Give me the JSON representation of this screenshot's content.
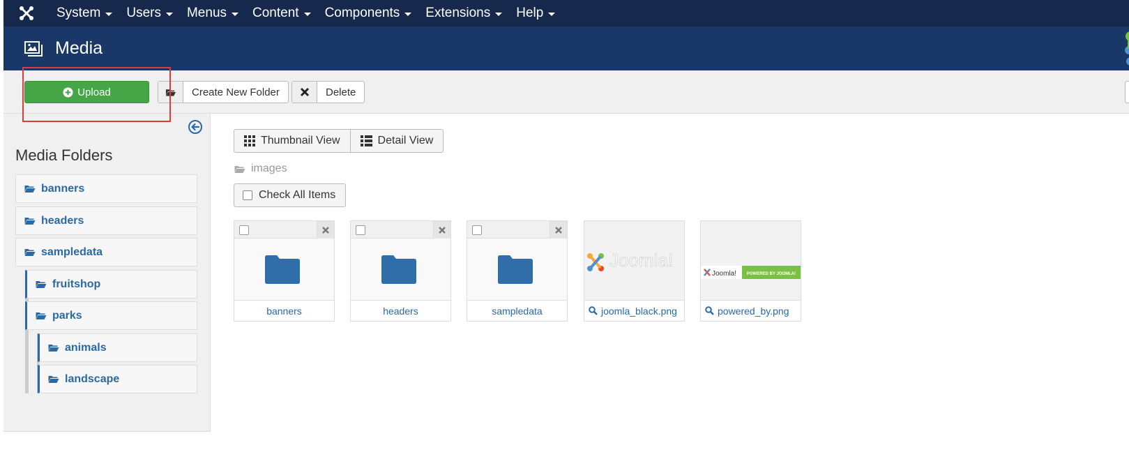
{
  "topnav": {
    "menus": [
      {
        "label": "System"
      },
      {
        "label": "Users"
      },
      {
        "label": "Menus"
      },
      {
        "label": "Content"
      },
      {
        "label": "Components"
      },
      {
        "label": "Extensions"
      },
      {
        "label": "Help"
      }
    ]
  },
  "header": {
    "title": "Media"
  },
  "toolbar": {
    "upload_label": "Upload",
    "new_folder_label": "Create New Folder",
    "delete_label": "Delete"
  },
  "sidebar": {
    "title": "Media Folders",
    "folders": [
      {
        "label": "banners"
      },
      {
        "label": "headers"
      },
      {
        "label": "sampledata"
      },
      {
        "label": "fruitshop"
      },
      {
        "label": "parks"
      },
      {
        "label": "animals"
      },
      {
        "label": "landscape"
      }
    ]
  },
  "main": {
    "views": {
      "thumbnail": "Thumbnail View",
      "detail": "Detail View"
    },
    "breadcrumb": "images",
    "check_all": "Check All Items",
    "items": [
      {
        "name": "banners",
        "kind": "folder"
      },
      {
        "name": "headers",
        "kind": "folder"
      },
      {
        "name": "sampledata",
        "kind": "folder"
      },
      {
        "name": "joomla_black.png",
        "kind": "image",
        "logo_text": "Joomla!"
      },
      {
        "name": "powered_by.png",
        "kind": "image",
        "logo_text": "Joomla!",
        "badge_text": "POWERED BY JOOMLA!"
      }
    ]
  },
  "colors": {
    "topnav_bg": "#16284b",
    "header_bg": "#1a3867",
    "upload_green": "#46a546",
    "link_blue": "#2a69a4",
    "highlight_red": "#e03a3a"
  }
}
